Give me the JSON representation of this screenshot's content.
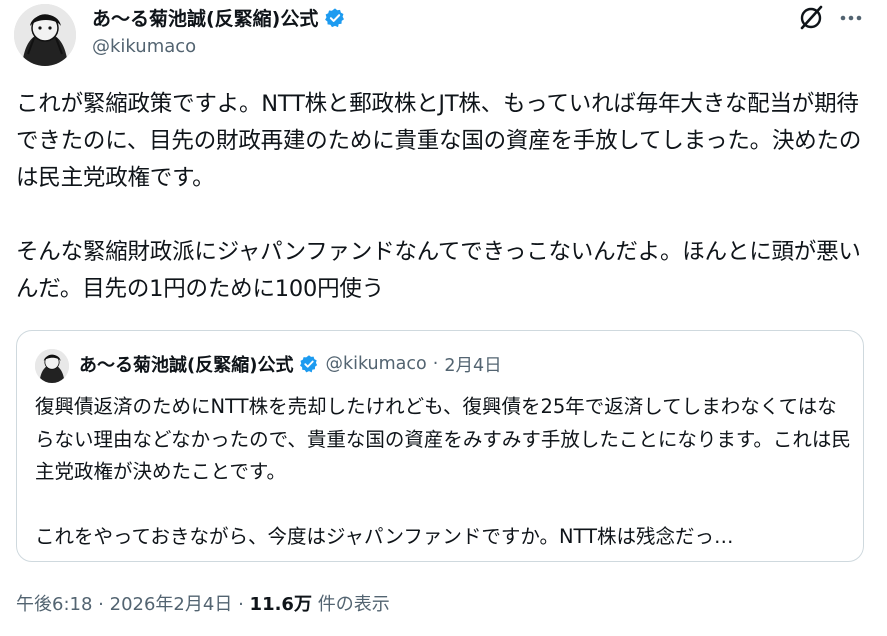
{
  "author": {
    "name": "あ〜る菊池誠(反緊縮)公式",
    "handle": "@kikumaco"
  },
  "post": {
    "text": "これが緊縮政策ですよ。NTT株と郵政株とJT株、もっていれば毎年大きな配当が期待できたのに、目先の財政再建のために貴重な国の資産を手放してしまった。決めたのは民主党政権です。\n\nそんな緊縮財政派にジャパンファンドなんてできっこないんだよ。ほんとに頭が悪いんだ。目先の1円のために100円使う"
  },
  "quote": {
    "name": "あ〜る菊池誠(反緊縮)公式",
    "handle": "@kikumaco",
    "separator": "·",
    "date": "2月4日",
    "text": "復興債返済のためにNTT株を売却したけれども、復興債を25年で返済してしまわなくてはならない理由などなかったので、貴重な国の資産をみすみす手放したことになります。これは民主党政権が決めたことです。\n\nこれをやっておきながら、今度はジャパンファンドですか。NTT株は残念だっ…"
  },
  "meta": {
    "time": "午後6:18",
    "sep1": "·",
    "date": "2026年2月4日",
    "sep2": "·",
    "views": "11.6万",
    "views_label": "件の表示"
  },
  "colors": {
    "verified": "#1d9bf0",
    "secondary_text": "#536471",
    "border": "#cfd9de"
  },
  "icons": [
    "grok-icon",
    "more-icon",
    "verified-badge-icon"
  ]
}
